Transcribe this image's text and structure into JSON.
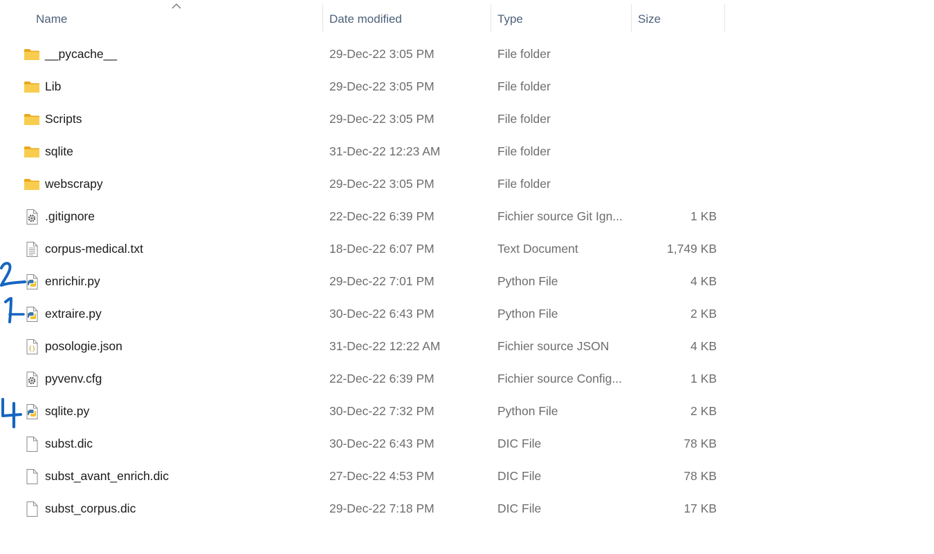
{
  "columns": {
    "name": "Name",
    "date": "Date modified",
    "type": "Type",
    "size": "Size"
  },
  "sort": {
    "column": "name",
    "direction": "ascending"
  },
  "files": [
    {
      "name": "__pycache__",
      "date": "29-Dec-22 3:05 PM",
      "type": "File folder",
      "size": "",
      "icon": "folder-icon"
    },
    {
      "name": "Lib",
      "date": "29-Dec-22 3:05 PM",
      "type": "File folder",
      "size": "",
      "icon": "folder-icon"
    },
    {
      "name": "Scripts",
      "date": "29-Dec-22 3:05 PM",
      "type": "File folder",
      "size": "",
      "icon": "folder-icon"
    },
    {
      "name": "sqlite",
      "date": "31-Dec-22 12:23 AM",
      "type": "File folder",
      "size": "",
      "icon": "folder-icon"
    },
    {
      "name": "webscrapy",
      "date": "29-Dec-22 3:05 PM",
      "type": "File folder",
      "size": "",
      "icon": "folder-icon"
    },
    {
      "name": ".gitignore",
      "date": "22-Dec-22 6:39 PM",
      "type": "Fichier source Git Ign...",
      "size": "1 KB",
      "icon": "settings-file-icon"
    },
    {
      "name": "corpus-medical.txt",
      "date": "18-Dec-22 6:07 PM",
      "type": "Text Document",
      "size": "1,749 KB",
      "icon": "text-file-icon"
    },
    {
      "name": "enrichir.py",
      "date": "29-Dec-22 7:01 PM",
      "type": "Python File",
      "size": "4 KB",
      "icon": "python-file-icon"
    },
    {
      "name": "extraire.py",
      "date": "30-Dec-22 6:43 PM",
      "type": "Python File",
      "size": "2 KB",
      "icon": "python-file-icon"
    },
    {
      "name": "posologie.json",
      "date": "31-Dec-22 12:22 AM",
      "type": "Fichier source JSON",
      "size": "4 KB",
      "icon": "json-file-icon"
    },
    {
      "name": "pyvenv.cfg",
      "date": "22-Dec-22 6:39 PM",
      "type": "Fichier source Config...",
      "size": "1 KB",
      "icon": "settings-file-icon"
    },
    {
      "name": "sqlite.py",
      "date": "30-Dec-22 7:32 PM",
      "type": "Python File",
      "size": "2 KB",
      "icon": "python-file-icon"
    },
    {
      "name": "subst.dic",
      "date": "30-Dec-22 6:43 PM",
      "type": "DIC File",
      "size": "78 KB",
      "icon": "blank-file-icon"
    },
    {
      "name": "subst_avant_enrich.dic",
      "date": "27-Dec-22 4:53 PM",
      "type": "DIC File",
      "size": "78 KB",
      "icon": "blank-file-icon"
    },
    {
      "name": "subst_corpus.dic",
      "date": "29-Dec-22 7:18 PM",
      "type": "DIC File",
      "size": "17 KB",
      "icon": "blank-file-icon"
    }
  ],
  "annotations": [
    {
      "text": "2",
      "file": "enrichir.py",
      "color": "#1565c0"
    },
    {
      "text": "1",
      "file": "extraire.py",
      "color": "#1565c0"
    },
    {
      "text": "4",
      "file": "sqlite.py",
      "color": "#1565c0"
    }
  ],
  "colors": {
    "header_text": "#4c607a",
    "folder": "#f5c443",
    "annotation_ink": "#1565c0"
  }
}
